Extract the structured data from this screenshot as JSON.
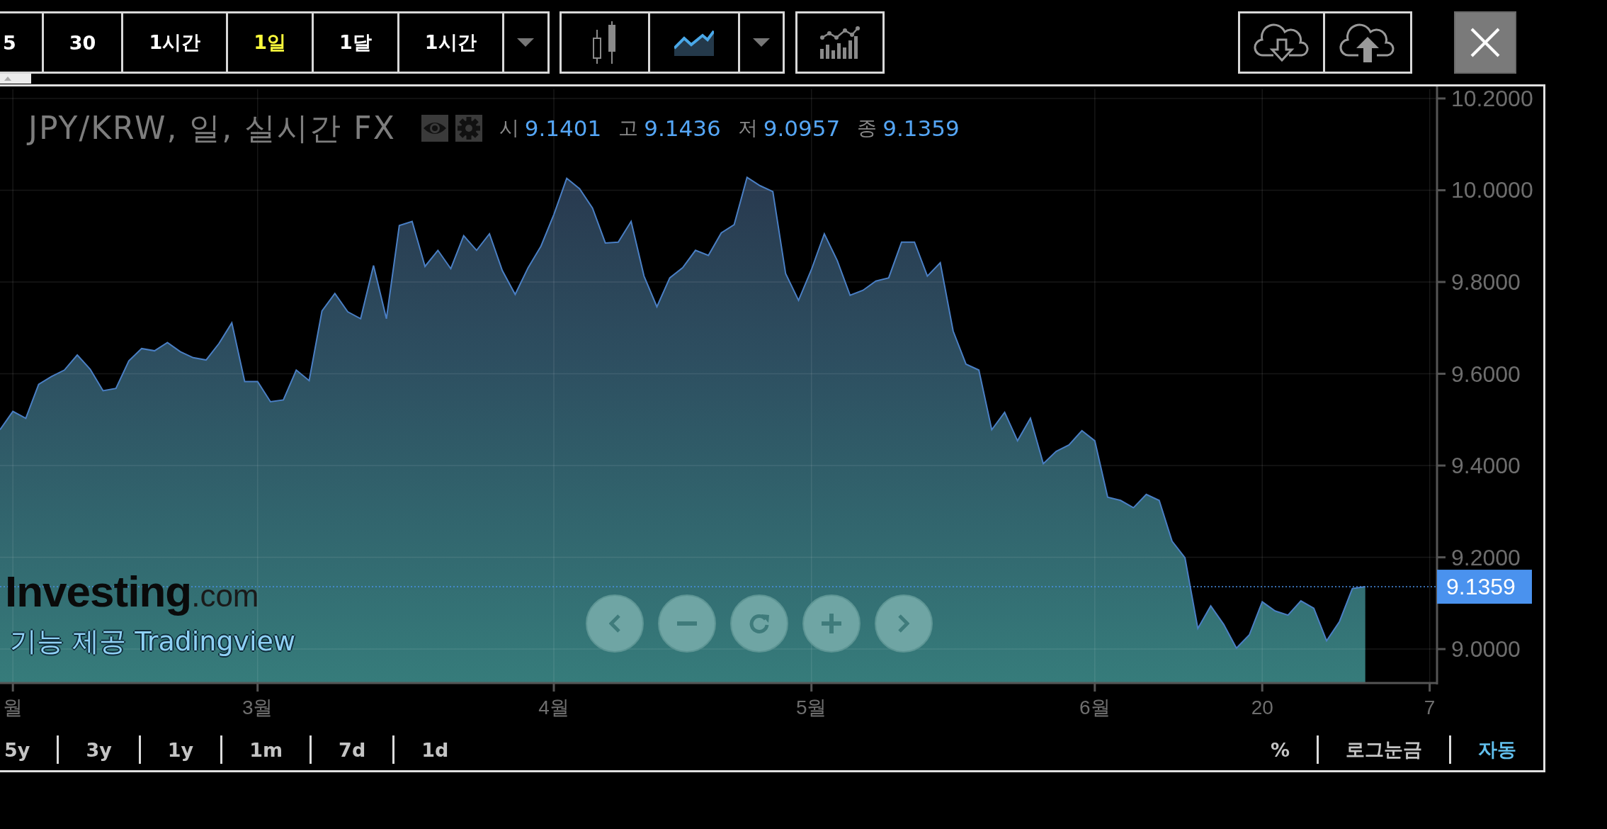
{
  "toolbar": {
    "intervals": [
      {
        "label": "5",
        "selected": false
      },
      {
        "label": "30",
        "selected": false
      },
      {
        "label": "1시간",
        "selected": false
      },
      {
        "label": "1일",
        "selected": true
      },
      {
        "label": "1달",
        "selected": false
      },
      {
        "label": "1시간",
        "selected": false
      }
    ],
    "chart_types": [
      {
        "kind": "candlestick",
        "selected": false
      },
      {
        "kind": "area",
        "selected": true
      }
    ]
  },
  "legend": {
    "title": "JPY/KRW, 일, 실시간 FX",
    "ohlc": [
      {
        "label": "시",
        "value": "9.1401"
      },
      {
        "label": "고",
        "value": "9.1436"
      },
      {
        "label": "저",
        "value": "9.0957"
      },
      {
        "label": "종",
        "value": "9.1359"
      }
    ]
  },
  "chart": {
    "chart_data": {
      "type": "area",
      "categories": [
        null,
        "월",
        null,
        null,
        null,
        null,
        null,
        null,
        null,
        null,
        null,
        null,
        null,
        null,
        null,
        null,
        null,
        null,
        null,
        null,
        "3월",
        null,
        null,
        null,
        null,
        null,
        null,
        null,
        null,
        null,
        null,
        null,
        null,
        null,
        null,
        null,
        null,
        null,
        null,
        null,
        null,
        null,
        null,
        "4월",
        null,
        null,
        null,
        null,
        null,
        null,
        null,
        null,
        null,
        null,
        null,
        null,
        null,
        null,
        null,
        null,
        null,
        null,
        null,
        "5월",
        null,
        null,
        null,
        null,
        null,
        null,
        null,
        null,
        null,
        null,
        null,
        null,
        null,
        null,
        null,
        null,
        null,
        null,
        null,
        null,
        null,
        "6월",
        null,
        null,
        null,
        null,
        null,
        null,
        null,
        null,
        null,
        null,
        null,
        null,
        "20",
        null,
        null,
        null,
        null,
        null,
        null,
        null,
        null,
        null,
        null,
        null,
        null,
        "7"
      ],
      "values": [
        9.478,
        9.518,
        9.503,
        9.577,
        9.594,
        9.608,
        9.641,
        9.61,
        9.563,
        9.568,
        9.628,
        9.655,
        9.65,
        9.668,
        9.648,
        9.635,
        9.63,
        9.666,
        9.711,
        9.583,
        9.583,
        9.539,
        9.543,
        9.608,
        9.585,
        9.737,
        9.775,
        9.735,
        9.72,
        9.836,
        9.72,
        9.923,
        9.932,
        9.834,
        9.869,
        9.829,
        9.901,
        9.869,
        9.905,
        9.825,
        9.773,
        9.831,
        9.878,
        9.947,
        10.026,
        10.003,
        9.961,
        9.885,
        9.887,
        9.932,
        9.813,
        9.746,
        9.809,
        9.831,
        9.869,
        9.858,
        9.907,
        9.925,
        10.028,
        10.01,
        9.997,
        9.818,
        9.76,
        9.827,
        9.905,
        9.847,
        9.771,
        9.782,
        9.802,
        9.809,
        9.887,
        9.887,
        9.813,
        9.842,
        9.693,
        9.621,
        9.608,
        9.478,
        9.516,
        9.454,
        9.503,
        9.404,
        9.431,
        9.445,
        9.476,
        9.454,
        9.331,
        9.324,
        9.308,
        9.337,
        9.324,
        9.235,
        9.199,
        9.045,
        9.094,
        9.054,
        9.002,
        9.031,
        9.103,
        9.083,
        9.074,
        9.105,
        9.089,
        9.018,
        9.06,
        9.132,
        9.136,
        null,
        null,
        null,
        null,
        null
      ],
      "ylim": [
        8.926,
        10.22
      ],
      "yticks": [
        {
          "value": 9,
          "label": "9.0000"
        },
        {
          "value": 9.2,
          "label": "9.2000"
        },
        {
          "value": 9.4,
          "label": "9.4000"
        },
        {
          "value": 9.6,
          "label": "9.6000"
        },
        {
          "value": 9.8,
          "label": "9.8000"
        },
        {
          "value": 10,
          "label": "10.0000"
        },
        {
          "value": 10.2,
          "label": "10.2000"
        }
      ],
      "grid": true,
      "ref_lines": [
        {
          "axis": "y",
          "value": 9.1359,
          "label": "9.1359"
        }
      ]
    },
    "branding": {
      "logo": "**Investing**.com",
      "credit": "기능 제공 Tradingview"
    }
  },
  "ranges": [
    "5y",
    "3y",
    "1y",
    "1m",
    "7d",
    "1d"
  ],
  "scale_options": [
    {
      "label": "%",
      "on": false
    },
    {
      "label": "로그눈금",
      "on": false
    },
    {
      "label": "자동",
      "on": true
    }
  ]
}
